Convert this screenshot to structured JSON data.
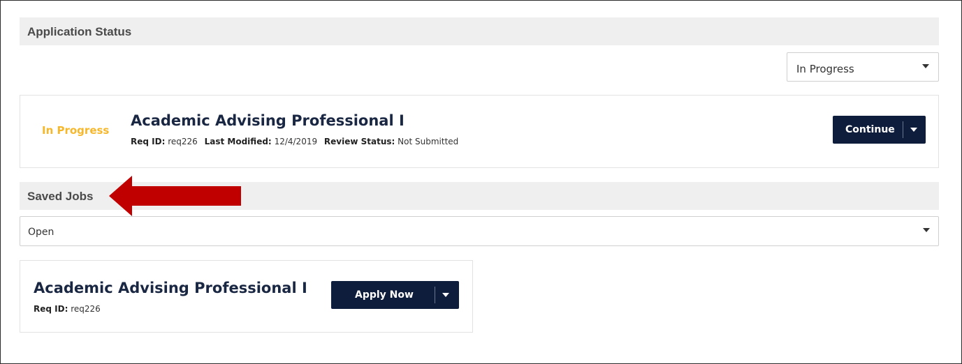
{
  "application_status": {
    "header": "Application Status",
    "filter_value": "In Progress",
    "card": {
      "status": "In Progress",
      "title": "Academic Advising Professional I",
      "req_id_label": "Req ID:",
      "req_id_value": "req226",
      "last_modified_label": "Last Modified:",
      "last_modified_value": "12/4/2019",
      "review_status_label": "Review Status:",
      "review_status_value": "Not Submitted",
      "action_label": "Continue"
    }
  },
  "saved_jobs": {
    "header": "Saved Jobs",
    "filter_value": "Open",
    "card": {
      "title": "Academic Advising Professional I",
      "req_id_label": "Req ID:",
      "req_id_value": "req226",
      "action_label": "Apply Now"
    }
  },
  "colors": {
    "status_in_progress": "#f6b72b",
    "button_bg": "#0f1d3c",
    "title_color": "#1a2743",
    "annotation_arrow": "#c00000",
    "header_bg": "#efefef"
  },
  "icons": {
    "dropdown": "caret-down-icon",
    "annotation": "left-arrow-annotation"
  }
}
